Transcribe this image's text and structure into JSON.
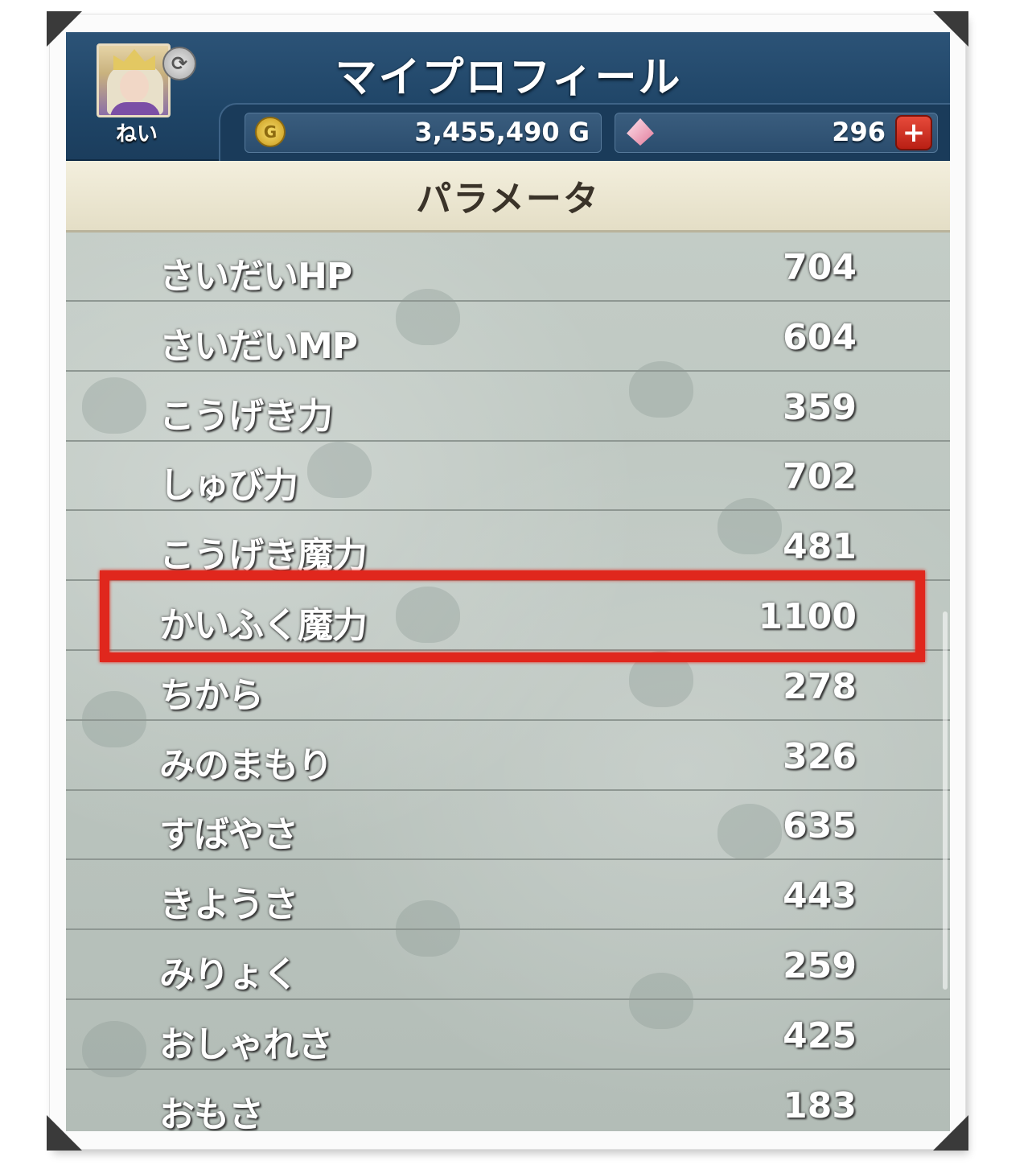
{
  "header": {
    "title": "マイプロフィール",
    "player_name": "ねい",
    "avatar_icon": "character-portrait",
    "refresh_icon": "refresh-icon",
    "gold_value": "3,455,490 G",
    "gold_icon_glyph": "G",
    "gem_value": "296",
    "gem_icon": "gem-icon",
    "plus_label": "+"
  },
  "section": {
    "title": "パラメータ"
  },
  "params": [
    {
      "name": "さいだいHP",
      "value": "704"
    },
    {
      "name": "さいだいMP",
      "value": "604"
    },
    {
      "name": "こうげき力",
      "value": "359"
    },
    {
      "name": "しゅび力",
      "value": "702"
    },
    {
      "name": "こうげき魔力",
      "value": "481"
    },
    {
      "name": "かいふく魔力",
      "value": "1100"
    },
    {
      "name": "ちから",
      "value": "278"
    },
    {
      "name": "みのまもり",
      "value": "326"
    },
    {
      "name": "すばやさ",
      "value": "635"
    },
    {
      "name": "きようさ",
      "value": "443"
    },
    {
      "name": "みりょく",
      "value": "259"
    },
    {
      "name": "おしゃれさ",
      "value": "425"
    },
    {
      "name": "おもさ",
      "value": "183"
    }
  ],
  "highlight": {
    "row_index": 5,
    "color": "#e0271d"
  },
  "colors": {
    "header_bg": "#1f4567",
    "section_bg": "#ece7d2",
    "list_bg": "#bcc6c0"
  }
}
